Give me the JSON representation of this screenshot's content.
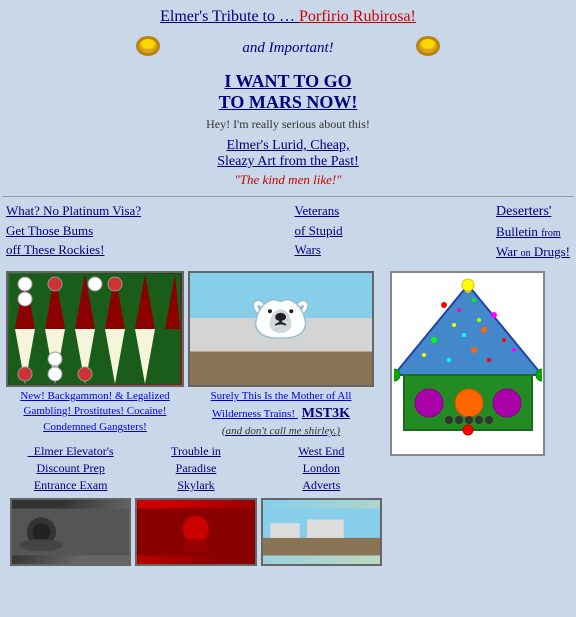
{
  "header": {
    "tribute_prefix": "Elmer's Tribute to …",
    "tribute_link": "Porfirio Rubirosa!",
    "important_text": "and Important!",
    "mars_line1": "I WANT TO GO",
    "mars_line2": "TO MARS NOW!",
    "serious_text": "Hey! I'm really serious about this!",
    "lurid_title": "Elmer's Lurid, Cheap,",
    "lurid_subtitle": "Sleazy Art from the Past!",
    "kind_men": "\"The kind men like!\""
  },
  "nav": {
    "col1_line1": "What? No Platinum Visa?",
    "col1_line2": "Get Those Bums",
    "col1_line3": "off These Rockies!",
    "col2_line1": "Veterans",
    "col2_line2": "of Stupid",
    "col2_line3": "Wars",
    "col3_line1": "Deserters'",
    "col3_line2": "Bulletin",
    "col3_from": "from",
    "col3_line3": "War",
    "col3_on": "on",
    "col3_line4": "Drugs!"
  },
  "images": {
    "backgammon_caption": "New! Backgammon! & Legalized Gambling! Prostitutes! Cocaine! Condemned Gangsters!",
    "polarbear_caption": "Surely This Is the Mother of All Wilderness Trains!",
    "polarbear_sub": "(and don't call me shirley.)",
    "mst3k_label": "MST3K",
    "bottom_link1_line1": "_Elmer Elevator's",
    "bottom_link1_line2": "Discount Prep",
    "bottom_link1_line3": "Entrance Exam",
    "bottom_link2_line1": "Trouble in",
    "bottom_link2_line2": "Paradise",
    "bottom_link2_line3": "Skylark",
    "bottom_link3_line1": "West End",
    "bottom_link3_line2": "London",
    "bottom_link3_line3": "Adverts"
  },
  "triangle": {
    "label": "triangle graphic"
  }
}
